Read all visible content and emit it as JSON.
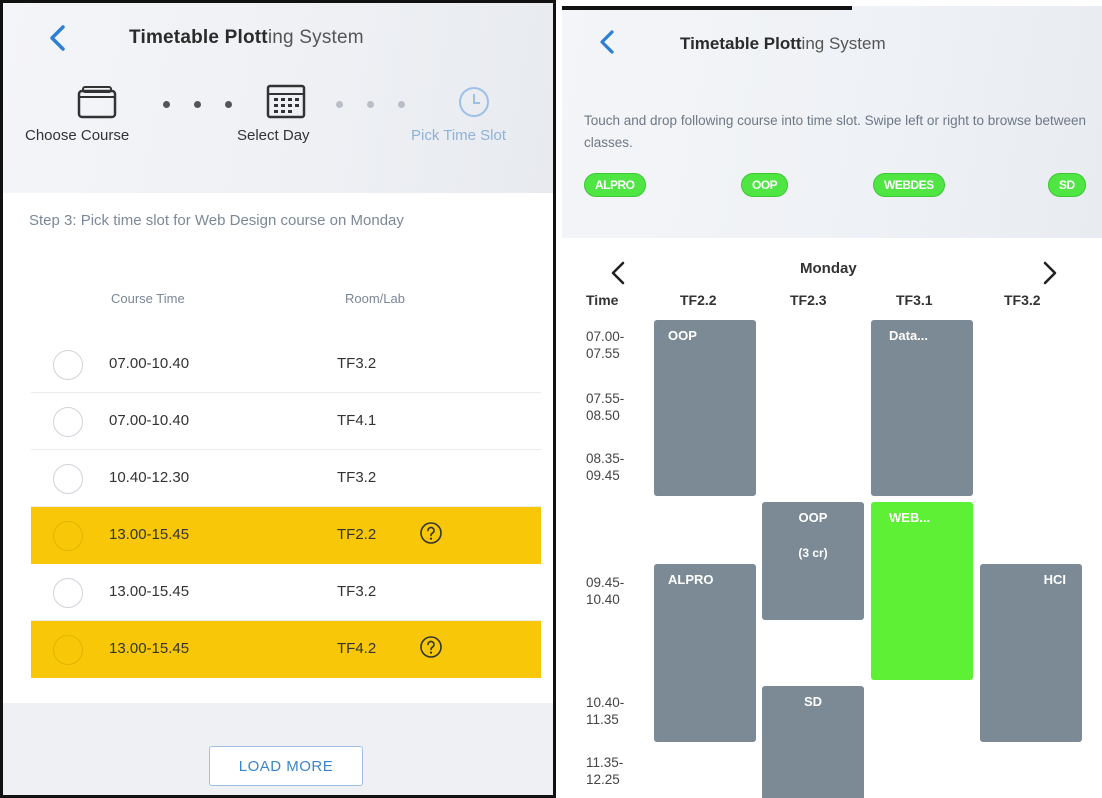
{
  "left": {
    "title_bold": "Timetable Plott",
    "title_light": "ing System",
    "steps": [
      {
        "label": "Choose Course",
        "icon": "folder-icon"
      },
      {
        "label": "Select Day",
        "icon": "calendar-icon"
      },
      {
        "label": "Pick Time Slot",
        "icon": "clock-icon"
      }
    ],
    "instruction": "Step 3: Pick time slot for Web Design course on Monday",
    "columns": {
      "time": "Course Time",
      "room": "Room/Lab"
    },
    "slots": [
      {
        "time": "07.00-10.40",
        "room": "TF3.2",
        "selected": false,
        "help": false
      },
      {
        "time": "07.00-10.40",
        "room": "TF4.1",
        "selected": false,
        "help": false
      },
      {
        "time": "10.40-12.30",
        "room": "TF3.2",
        "selected": false,
        "help": false
      },
      {
        "time": "13.00-15.45",
        "room": "TF2.2",
        "selected": true,
        "help": true
      },
      {
        "time": "13.00-15.45",
        "room": "TF3.2",
        "selected": false,
        "help": false
      },
      {
        "time": "13.00-15.45",
        "room": "TF4.2",
        "selected": true,
        "help": true
      }
    ],
    "load_more": "LOAD MORE",
    "colors": {
      "highlight": "#f7c708",
      "accent": "#3b84c9",
      "active_step": "#8fb2d8"
    }
  },
  "right": {
    "title_bold": "Timetable Plott",
    "title_light": "ing System",
    "instruction": "Touch and drop following course into time slot. Swipe left or right to browse between classes.",
    "courses": [
      "ALPRO",
      "OOP",
      "WEBDES",
      "SD"
    ],
    "day": "Monday",
    "time_header": "Time",
    "rooms": [
      "TF2.2",
      "TF2.3",
      "TF3.1",
      "TF3.2"
    ],
    "time_slots": [
      "07.00-\n07.55",
      "07.55-\n08.50",
      "08.35-\n09.45",
      "09.45-\n10.40",
      "10.40-\n11.35",
      "11.35-\n12.25"
    ],
    "blocks": {
      "oop_tf22": "OOP",
      "data_tf31": "Data...",
      "oop_tf23": "OOP",
      "oop_tf23_sub": "(3 cr)",
      "web_tf31": "WEB...",
      "alpro_tf22": "ALPRO",
      "hci_tf32": "HCI",
      "sd_tf23": "SD"
    },
    "colors": {
      "chip": "#4fe644",
      "block": "#7b8a94",
      "dropped": "#5ef034"
    }
  }
}
